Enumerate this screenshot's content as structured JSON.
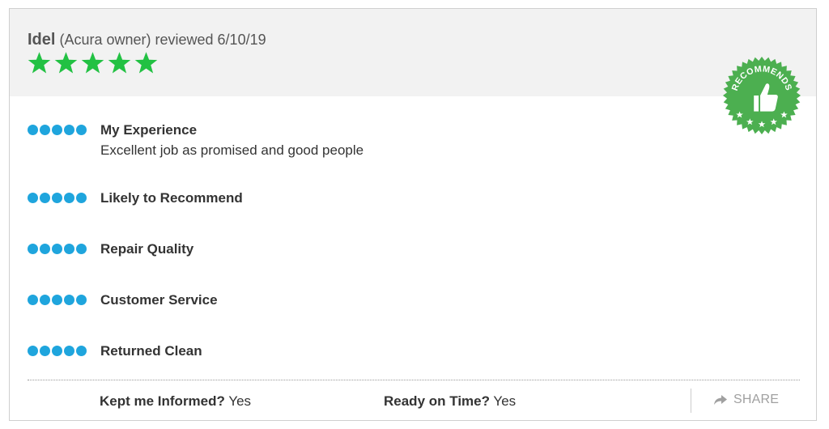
{
  "review": {
    "reviewer_name": "Idel",
    "reviewer_meta": "(Acura owner) reviewed 6/10/19",
    "overall_rating": 5,
    "overall_rating_max": 5,
    "badge": {
      "text": "RECOMMENDS",
      "icon": "thumbs-up-icon",
      "color": "#4caf50"
    },
    "ratings": [
      {
        "label": "My Experience",
        "score": 5,
        "max": 5,
        "comment": "Excellent job as promised and good people"
      },
      {
        "label": "Likely to Recommend",
        "score": 5,
        "max": 5,
        "comment": ""
      },
      {
        "label": "Repair Quality",
        "score": 5,
        "max": 5,
        "comment": ""
      },
      {
        "label": "Customer Service",
        "score": 5,
        "max": 5,
        "comment": ""
      },
      {
        "label": "Returned Clean",
        "score": 5,
        "max": 5,
        "comment": ""
      }
    ],
    "footer": {
      "kept_informed_q": "Kept me Informed?",
      "kept_informed_a": "Yes",
      "ready_on_time_q": "Ready on Time?",
      "ready_on_time_a": "Yes",
      "share_label": "SHARE",
      "share_icon": "share-arrow-icon"
    }
  },
  "colors": {
    "star_green": "#22c143",
    "dot_blue": "#1fa5dd",
    "badge_green": "#4caf50",
    "header_bg": "#f2f2f2"
  }
}
